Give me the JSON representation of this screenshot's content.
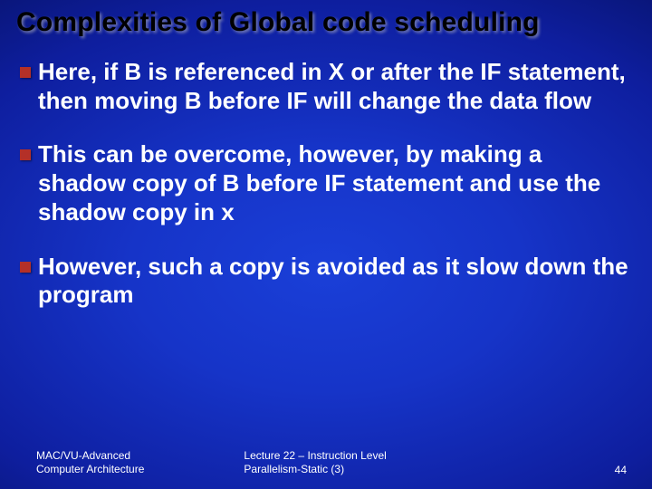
{
  "slide": {
    "title": "Complexities of Global code scheduling",
    "bullets": [
      "Here, if B is referenced in X or after the IF statement, then moving B before IF will change the data flow",
      "This can be overcome, however, by making a shadow copy of B before IF statement and use the shadow copy in x",
      "However, such a copy is avoided as it slow down the program"
    ],
    "footer": {
      "left_line1": "MAC/VU-Advanced",
      "left_line2": "Computer Architecture",
      "center_line1": "Lecture 22 – Instruction Level",
      "center_line2": "Parallelism-Static (3)",
      "page_number": "44"
    }
  },
  "colors": {
    "bullet": "#b43028",
    "title": "#000000",
    "text": "#ffffff"
  }
}
